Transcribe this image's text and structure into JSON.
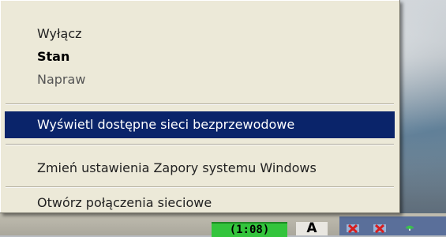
{
  "context_menu": {
    "items": [
      {
        "label": "Wyłącz"
      },
      {
        "label": "Stan"
      },
      {
        "label": "Napraw"
      },
      {
        "label": "Wyświetl dostępne sieci bezprzewodowe"
      },
      {
        "label": "Zmień ustawienia Zapory systemu Windows"
      },
      {
        "label": "Otwórz połączenia sieciowe"
      }
    ],
    "selected_item": "Wyświetl dostępne sieci bezprzewodowe",
    "highlight_color": "#0a246a"
  },
  "taskbar": {
    "clock_text": "(1:08)",
    "language_indicator": "A",
    "tray_icons": [
      "network-error-icon",
      "network-error-icon",
      "wireless-icon"
    ]
  }
}
